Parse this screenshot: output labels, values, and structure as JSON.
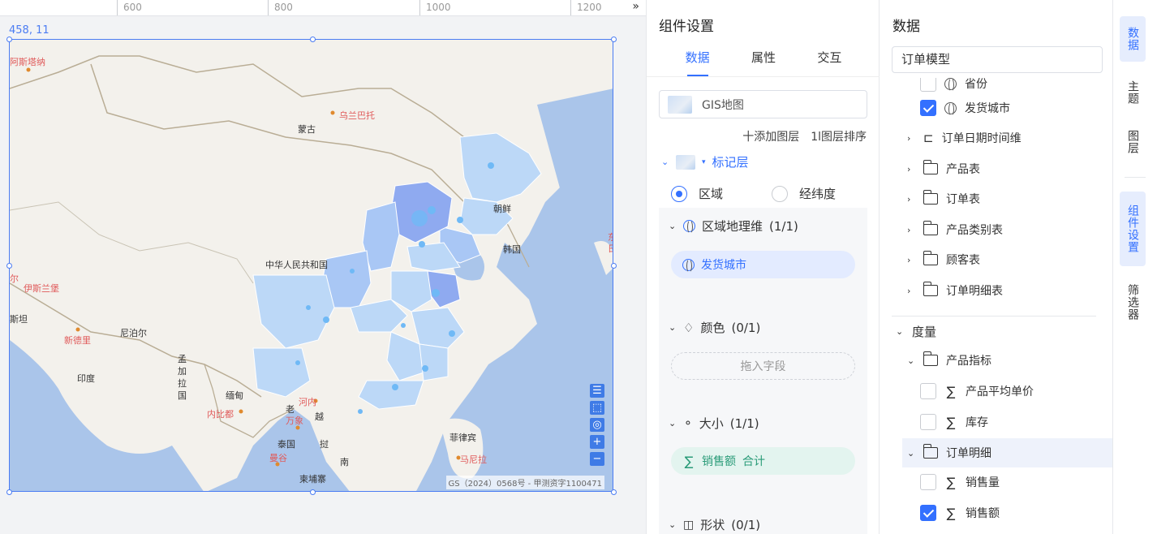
{
  "ruler": {
    "labels": [
      "600",
      "800",
      "1000",
      "1200"
    ],
    "toggle": "»"
  },
  "canvas": {
    "position_readout": "458, 11"
  },
  "map": {
    "labels": {
      "astana": "阿斯塔纳",
      "ulaanbaatar": "乌兰巴托",
      "mongolia": "蒙古",
      "korea_north": "朝鲜",
      "korea_south": "韩国",
      "china": "中华人民共和国",
      "islamabad_partial": "尔",
      "islamabad": "伊斯兰堡",
      "pakistan_partial": "斯坦",
      "new_delhi": "新德里",
      "nepal": "尼泊尔",
      "bangladesh": "孟加拉国",
      "india": "印度",
      "myanmar": "缅甸",
      "naypyidaw": "内比都",
      "laos": "老",
      "hanoi": "河内",
      "vientiane": "万象",
      "vietnam_1": "越",
      "thailand": "泰国",
      "bangkok": "曼谷",
      "laos_2": "挝",
      "vietnam_2": "南",
      "cambodia": "柬埔寨",
      "philippines": "菲律宾",
      "manila": "马尼拉",
      "tokyo_partial": "东",
      "japan_partial": "日"
    },
    "copyright": "GS（2024）0568号 - 甲测资字1100471",
    "controls": [
      "☰",
      "⬚",
      "◎",
      "+",
      "−"
    ]
  },
  "settings": {
    "title": "组件设置",
    "tabs": [
      "数据",
      "属性",
      "交互"
    ],
    "active_tab": "数据",
    "map_type": "GIS地图",
    "add_layer": "十添加图层",
    "sort_layer": "1l图层排序",
    "layer_name": "标记层",
    "radio": {
      "region": "区域",
      "latlng": "经纬度",
      "selected": "区域"
    },
    "sections": {
      "region_dim": {
        "label": "区域地理维",
        "count": "(1/1)",
        "field": "发货城市"
      },
      "color": {
        "label": "颜色",
        "count": "(0/1)",
        "placeholder": "拖入字段"
      },
      "size": {
        "label": "大小",
        "count": "(1/1)",
        "field": "销售额",
        "agg": "合计"
      },
      "shape": {
        "label": "形状",
        "count": "(0/1)"
      }
    }
  },
  "data_panel": {
    "title": "数据",
    "model": "订单模型",
    "dimensions": [
      {
        "label": "省份",
        "checked": false
      },
      {
        "label": "发货城市",
        "checked": true
      }
    ],
    "folders": [
      "订单日期时间维",
      "产品表",
      "订单表",
      "产品类别表",
      "顾客表",
      "订单明细表"
    ],
    "measures_label": "度量",
    "measure_groups": {
      "product_metrics": {
        "label": "产品指标",
        "items": [
          {
            "label": "产品平均单价",
            "checked": false
          },
          {
            "label": "库存",
            "checked": false
          }
        ]
      },
      "order_detail": {
        "label": "订单明细",
        "items": [
          {
            "label": "销售量",
            "checked": false
          },
          {
            "label": "销售额",
            "checked": true
          }
        ]
      }
    }
  },
  "side_tabs": [
    "数据",
    "主题",
    "图层",
    "组件设置",
    "筛选器"
  ],
  "active_side_tab": "组件设置",
  "colors": {
    "accent": "#3370ff",
    "sea": "#aac5ea",
    "land": "#f3f1ec",
    "region_light": "#bcd8f7",
    "region_mid": "#a9c7f5",
    "region_dark": "#8faaf0"
  }
}
